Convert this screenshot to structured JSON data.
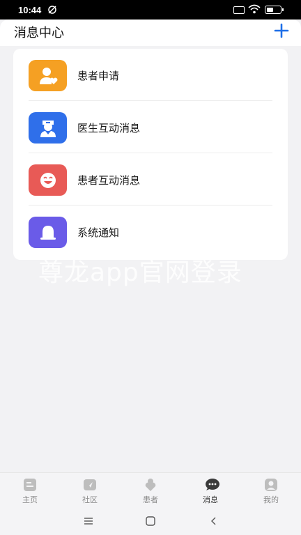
{
  "status": {
    "time": "10:44"
  },
  "header": {
    "title": "消息中心"
  },
  "messages": [
    {
      "label": "患者申请",
      "icon": "patient-heart-icon",
      "color": "#F5A023"
    },
    {
      "label": "医生互动消息",
      "icon": "doctor-icon",
      "color": "#2F6FEA"
    },
    {
      "label": "患者互动消息",
      "icon": "smile-icon",
      "color": "#E85A56"
    },
    {
      "label": "系统通知",
      "icon": "bell-icon",
      "color": "#6A5BE8"
    }
  ],
  "watermark": "尊龙app官网登录",
  "tabs": [
    {
      "label": "主页",
      "icon": "home-icon"
    },
    {
      "label": "社区",
      "icon": "community-icon"
    },
    {
      "label": "患者",
      "icon": "patient-icon"
    },
    {
      "label": "消息",
      "icon": "message-icon"
    },
    {
      "label": "我的",
      "icon": "profile-icon"
    }
  ],
  "colors": {
    "accent": "#1E6FE8",
    "background": "#F2F2F4"
  }
}
